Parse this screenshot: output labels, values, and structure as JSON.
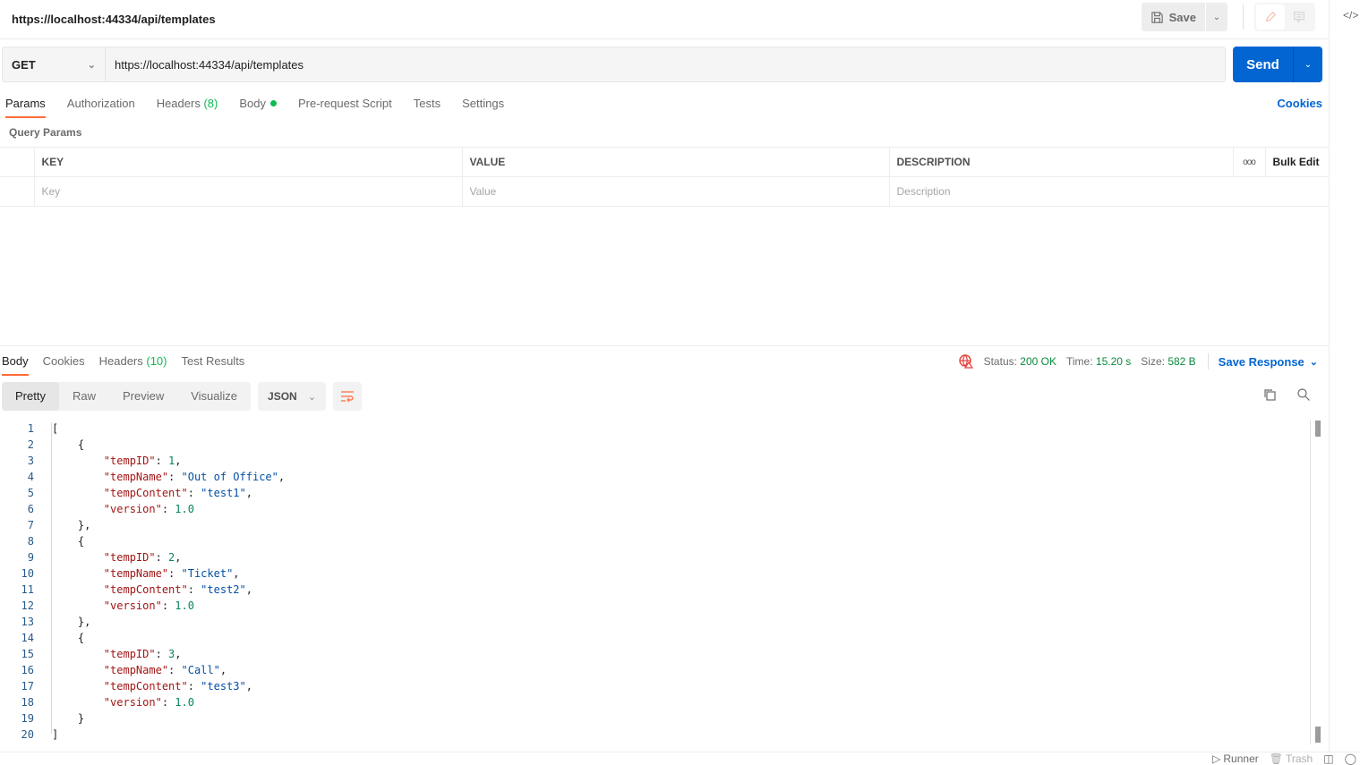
{
  "header": {
    "tab_title": "https://localhost:44334/api/templates",
    "save_label": "Save",
    "icons": [
      "save-icon",
      "chevron-down-icon",
      "pencil-icon",
      "comment-icon",
      "code-icon"
    ]
  },
  "request": {
    "method": "GET",
    "url": "https://localhost:44334/api/templates",
    "send_label": "Send",
    "tabs": [
      {
        "label": "Params",
        "active": true
      },
      {
        "label": "Authorization"
      },
      {
        "label": "Headers",
        "count": "(8)"
      },
      {
        "label": "Body",
        "dot": true
      },
      {
        "label": "Pre-request Script"
      },
      {
        "label": "Tests"
      },
      {
        "label": "Settings"
      }
    ],
    "cookies_label": "Cookies",
    "query_params_title": "Query Params",
    "table": {
      "headers": {
        "key": "KEY",
        "value": "VALUE",
        "description": "DESCRIPTION",
        "more": "ooo",
        "bulk_edit": "Bulk Edit"
      },
      "placeholders": {
        "key": "Key",
        "value": "Value",
        "description": "Description"
      }
    }
  },
  "response": {
    "tabs": [
      {
        "label": "Body",
        "active": true
      },
      {
        "label": "Cookies"
      },
      {
        "label": "Headers",
        "count": "(10)"
      },
      {
        "label": "Test Results"
      }
    ],
    "status_label": "Status:",
    "status_value": "200 OK",
    "time_label": "Time:",
    "time_value": "15.20 s",
    "size_label": "Size:",
    "size_value": "582 B",
    "save_response_label": "Save Response",
    "views": [
      "Pretty",
      "Raw",
      "Preview",
      "Visualize"
    ],
    "active_view": "Pretty",
    "format": "JSON",
    "body": [
      {
        "tempID": 1,
        "tempName": "Out of Office",
        "tempContent": "test1",
        "version": "1.0"
      },
      {
        "tempID": 2,
        "tempName": "Ticket",
        "tempContent": "test2",
        "version": "1.0"
      },
      {
        "tempID": 3,
        "tempName": "Call",
        "tempContent": "test3",
        "version": "1.0"
      }
    ]
  },
  "statusbar": {
    "runner": "Runner",
    "trash": "Trash"
  },
  "colors": {
    "accent": "#ff6c37",
    "primary": "#0265d2",
    "success": "#0cbb52"
  }
}
